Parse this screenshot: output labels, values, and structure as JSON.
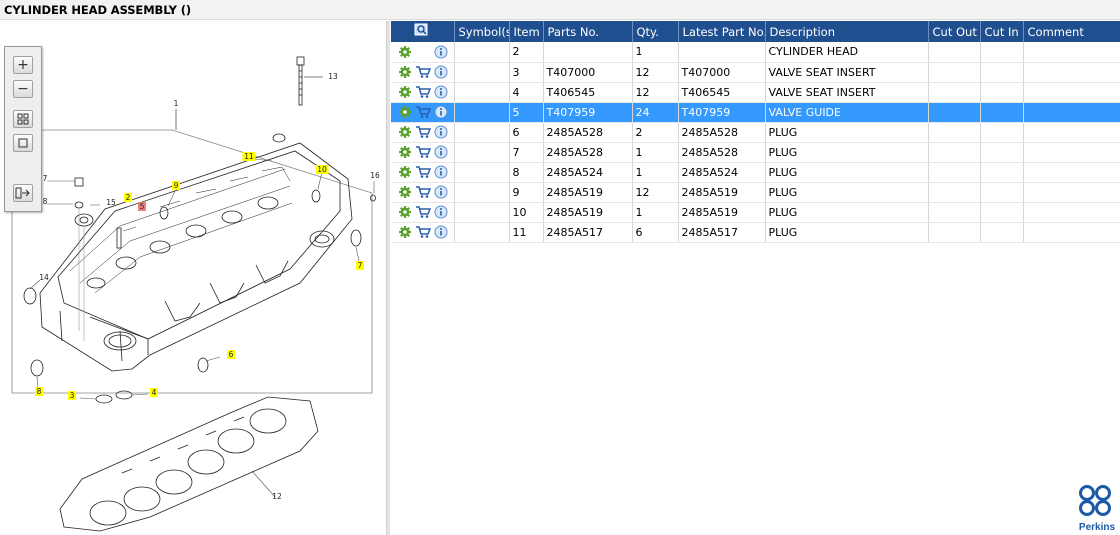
{
  "title": "CYLINDER HEAD ASSEMBLY ()",
  "brand": {
    "name": "Perkins",
    "color": "#1b5aa6"
  },
  "colors": {
    "header_bg": "#1f4f8f",
    "selected_row": "#3399ff",
    "callout_bg": "#ffff00",
    "callout_red": "#f08080"
  },
  "zoom_toolbar": {
    "buttons": [
      {
        "name": "zoom-in-icon"
      },
      {
        "name": "zoom-out-icon"
      },
      {
        "name": "zoom-window-icon"
      },
      {
        "name": "fit-page-icon"
      },
      {
        "name": "export-icon"
      }
    ]
  },
  "table": {
    "columns": [
      "Symbol(s)",
      "Item",
      "Parts No.",
      "Qty.",
      "Latest Part No.",
      "Description",
      "Cut Out",
      "Cut In",
      "Comment"
    ],
    "selected_index": 3,
    "rows": [
      {
        "cart": false,
        "item": "2",
        "part_no": "",
        "qty": "1",
        "latest": "",
        "description": "CYLINDER HEAD",
        "cut_out": "",
        "cut_in": "",
        "comment": ""
      },
      {
        "cart": true,
        "item": "3",
        "part_no": "T407000",
        "qty": "12",
        "latest": "T407000",
        "description": "VALVE SEAT INSERT",
        "cut_out": "",
        "cut_in": "",
        "comment": ""
      },
      {
        "cart": true,
        "item": "4",
        "part_no": "T406545",
        "qty": "12",
        "latest": "T406545",
        "description": "VALVE SEAT INSERT",
        "cut_out": "",
        "cut_in": "",
        "comment": ""
      },
      {
        "cart": true,
        "item": "5",
        "part_no": "T407959",
        "qty": "24",
        "latest": "T407959",
        "description": "VALVE GUIDE",
        "cut_out": "",
        "cut_in": "",
        "comment": ""
      },
      {
        "cart": true,
        "item": "6",
        "part_no": "2485A528",
        "qty": "2",
        "latest": "2485A528",
        "description": "PLUG",
        "cut_out": "",
        "cut_in": "",
        "comment": ""
      },
      {
        "cart": true,
        "item": "7",
        "part_no": "2485A528",
        "qty": "1",
        "latest": "2485A528",
        "description": "PLUG",
        "cut_out": "",
        "cut_in": "",
        "comment": ""
      },
      {
        "cart": true,
        "item": "8",
        "part_no": "2485A524",
        "qty": "1",
        "latest": "2485A524",
        "description": "PLUG",
        "cut_out": "",
        "cut_in": "",
        "comment": ""
      },
      {
        "cart": true,
        "item": "9",
        "part_no": "2485A519",
        "qty": "12",
        "latest": "2485A519",
        "description": "PLUG",
        "cut_out": "",
        "cut_in": "",
        "comment": ""
      },
      {
        "cart": true,
        "item": "10",
        "part_no": "2485A519",
        "qty": "1",
        "latest": "2485A519",
        "description": "PLUG",
        "cut_out": "",
        "cut_in": "",
        "comment": ""
      },
      {
        "cart": true,
        "item": "11",
        "part_no": "2485A517",
        "qty": "6",
        "latest": "2485A517",
        "description": "PLUG",
        "cut_out": "",
        "cut_in": "",
        "comment": ""
      }
    ]
  },
  "diagram": {
    "callouts": [
      {
        "text": "1",
        "hl": "none"
      },
      {
        "text": "2",
        "hl": "yellow"
      },
      {
        "text": "5",
        "hl": "red"
      },
      {
        "text": "3",
        "hl": "yellow"
      },
      {
        "text": "4",
        "hl": "yellow"
      },
      {
        "text": "6",
        "hl": "yellow"
      },
      {
        "text": "7",
        "hl": "yellow"
      },
      {
        "text": "8",
        "hl": "yellow"
      },
      {
        "text": "9",
        "hl": "yellow"
      },
      {
        "text": "10",
        "hl": "yellow"
      },
      {
        "text": "11",
        "hl": "yellow"
      },
      {
        "text": "12",
        "hl": "none"
      },
      {
        "text": "13",
        "hl": "none"
      },
      {
        "text": "14",
        "hl": "none"
      },
      {
        "text": "15",
        "hl": "none"
      },
      {
        "text": "16",
        "hl": "none"
      },
      {
        "text": "7",
        "hl": "none"
      },
      {
        "text": "8",
        "hl": "none"
      }
    ]
  }
}
